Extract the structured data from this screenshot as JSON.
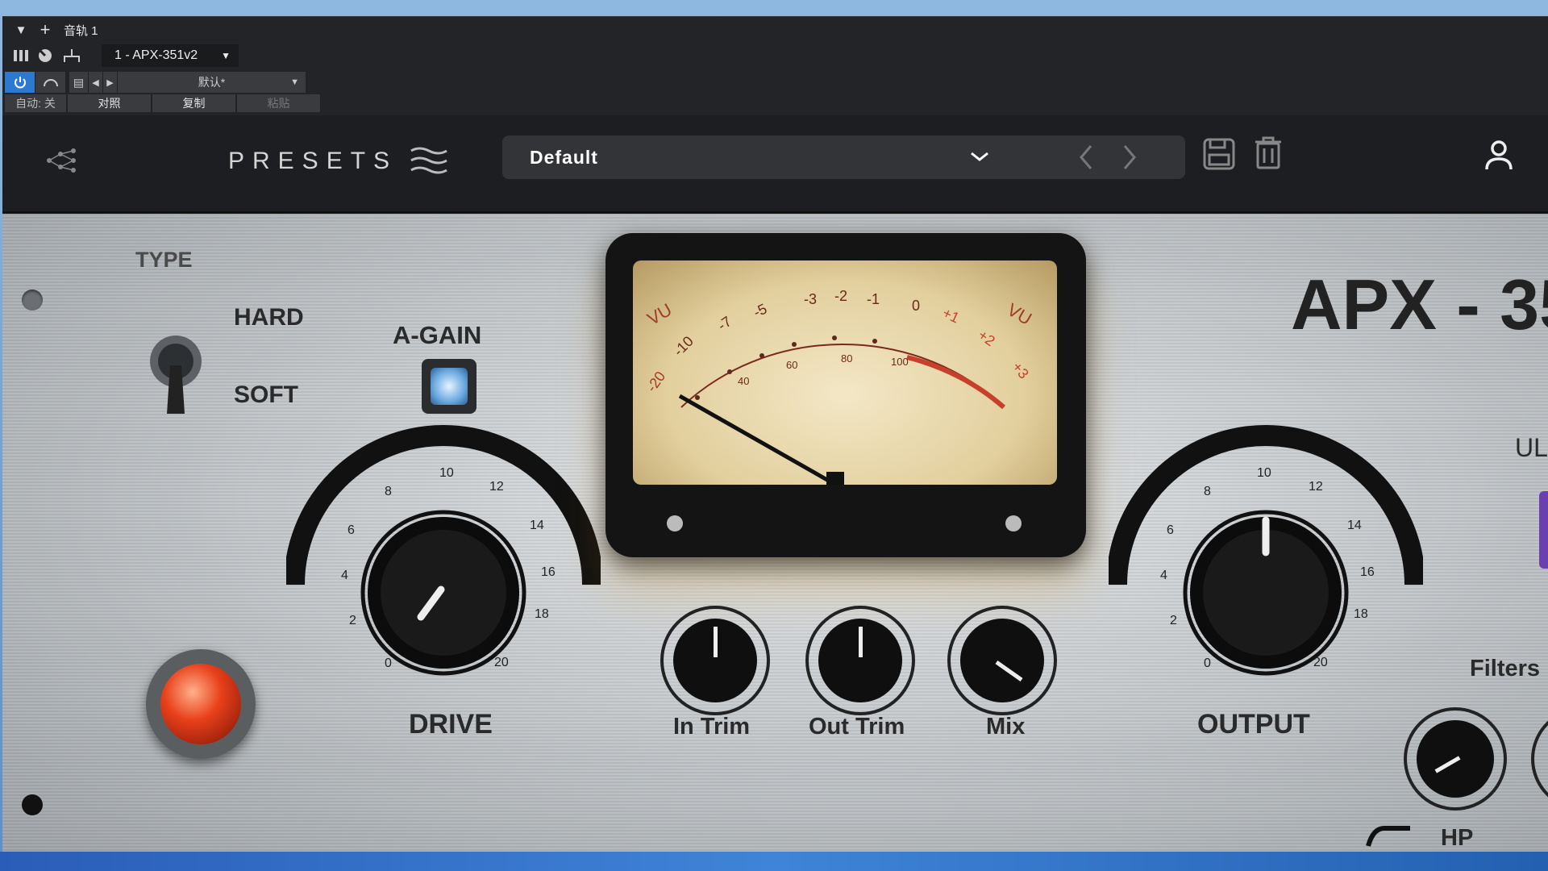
{
  "host": {
    "track_name": "音轨 1",
    "plugin_name": "1 - APX-351v2",
    "preset": "默认*",
    "auto_label": "自动: 关",
    "compare_label": "对照",
    "copy_label": "复制",
    "paste_label": "粘贴"
  },
  "toolbar": {
    "presets_label": "PRESETS",
    "preset_name": "Default"
  },
  "plugin": {
    "brand": "APX - 35",
    "type_label": "TYPE",
    "hard_label": "HARD",
    "soft_label": "SOFT",
    "again_label": "A-GAIN",
    "drive_label": "DRIVE",
    "output_label": "OUTPUT",
    "in_trim_label": "In Trim",
    "out_trim_label": "Out Trim",
    "mix_label": "Mix",
    "filters_label": "Filters",
    "hp_label": "HP",
    "ul_label": "UL",
    "scale": [
      "0",
      "2",
      "4",
      "6",
      "8",
      "10",
      "12",
      "14",
      "16",
      "18",
      "20"
    ],
    "meter_top": [
      "-20",
      "-10",
      "-7",
      "-5",
      "-3",
      "-2",
      "-1",
      "0",
      "+1",
      "+2",
      "+3"
    ],
    "meter_pct": [
      "40",
      "60",
      "80",
      "100"
    ],
    "vu_label": "VU"
  },
  "colors": {
    "power_on": "#2b79d0",
    "meter_red": "#c8402c",
    "lamp_red": "#e8401a"
  }
}
